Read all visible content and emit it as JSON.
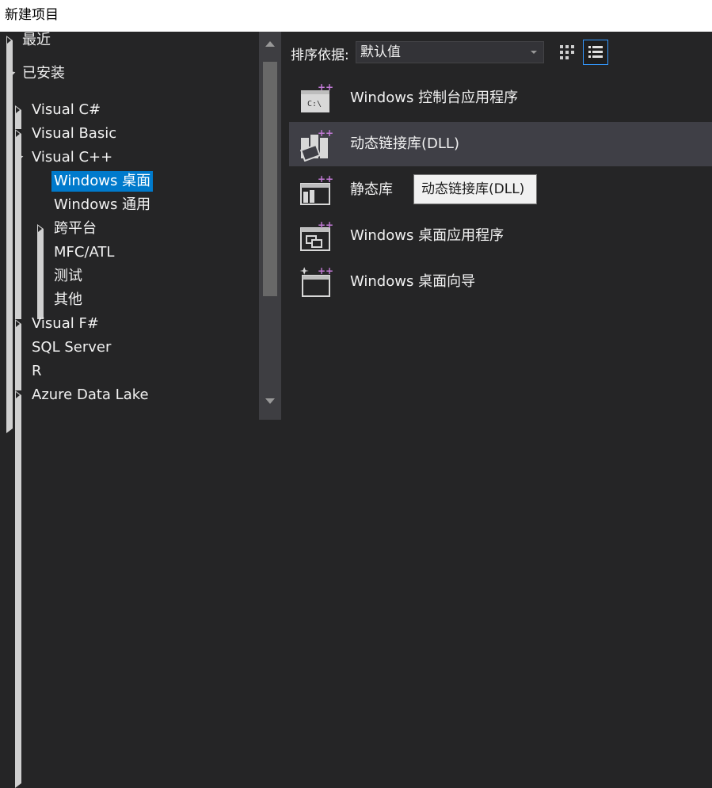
{
  "window": {
    "title": "新建项目"
  },
  "tree": {
    "items": [
      {
        "label": "最近",
        "name": "tree-item-recent",
        "expander": "right"
      },
      {
        "label": "已安装",
        "name": "tree-item-installed",
        "expander": "down"
      },
      {
        "label": "Visual C#",
        "name": "tree-item-visual-csharp",
        "expander": "right"
      },
      {
        "label": "Visual Basic",
        "name": "tree-item-visual-basic",
        "expander": "right"
      },
      {
        "label": "Visual C++",
        "name": "tree-item-visual-cpp",
        "expander": "down"
      },
      {
        "label": "Windows 桌面",
        "name": "tree-item-windows-desktop",
        "selected": true
      },
      {
        "label": "Windows 通用",
        "name": "tree-item-windows-universal"
      },
      {
        "label": "跨平台",
        "name": "tree-item-cross-platform",
        "expander": "right"
      },
      {
        "label": "MFC/ATL",
        "name": "tree-item-mfc-atl"
      },
      {
        "label": "测试",
        "name": "tree-item-test"
      },
      {
        "label": "其他",
        "name": "tree-item-other"
      },
      {
        "label": "Visual F#",
        "name": "tree-item-visual-fsharp",
        "expander": "right"
      },
      {
        "label": "SQL Server",
        "name": "tree-item-sql-server"
      },
      {
        "label": "R",
        "name": "tree-item-r"
      },
      {
        "label": "Azure Data Lake",
        "name": "tree-item-azure-data-lake",
        "expander": "right"
      }
    ]
  },
  "sort": {
    "label": "排序依据:",
    "value": "默认值"
  },
  "templates": [
    {
      "label": "Windows 控制台应用程序",
      "icon": "console-app-icon"
    },
    {
      "label": "动态链接库(DLL)",
      "icon": "dll-icon",
      "selected": true
    },
    {
      "label": "静态库",
      "icon": "static-library-icon"
    },
    {
      "label": "Windows 桌面应用程序",
      "icon": "desktop-app-icon"
    },
    {
      "label": "Windows 桌面向导",
      "icon": "desktop-wizard-icon"
    }
  ],
  "tooltip": {
    "text": "动态链接库(DLL)"
  },
  "colors": {
    "accent": "#007acc",
    "background": "#252526",
    "selected_row": "#3f3f46",
    "plus_badge": "#c27ad6"
  }
}
